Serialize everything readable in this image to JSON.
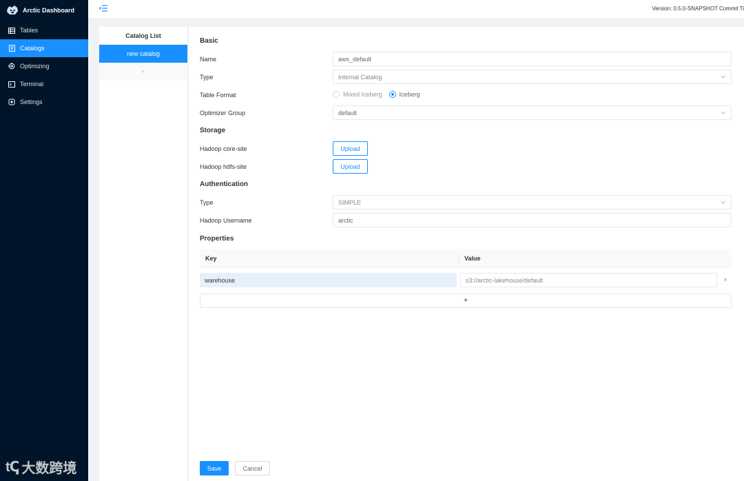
{
  "app": {
    "title": "Arctic Dashboard",
    "logo_icon": "arctic-bear-logo"
  },
  "header": {
    "version": "Version: 0.5.0-SNAPSHOT   Commit Ti"
  },
  "sidebar": {
    "items": [
      {
        "label": "Tables",
        "icon": "table-icon",
        "active": false
      },
      {
        "label": "Catalogs",
        "icon": "catalog-icon",
        "active": true
      },
      {
        "label": "Optimizing",
        "icon": "optimizing-icon",
        "active": false
      },
      {
        "label": "Terminal",
        "icon": "terminal-icon",
        "active": false
      },
      {
        "label": "Settings",
        "icon": "settings-icon",
        "active": false
      }
    ]
  },
  "catalog_list": {
    "title": "Catalog List",
    "items": [
      "new catalog"
    ],
    "add_label": "+"
  },
  "form": {
    "basic": {
      "title": "Basic",
      "name_label": "Name",
      "name_value": "aws_default",
      "type_label": "Type",
      "type_value": "Internal Catalog",
      "table_format_label": "Table Format",
      "table_format_options": [
        "Mixed Iceberg",
        "Iceberg"
      ],
      "table_format_selected": "Iceberg",
      "optimizer_group_label": "Optimizer Group",
      "optimizer_group_value": "default"
    },
    "storage": {
      "title": "Storage",
      "core_site_label": "Hadoop core-site",
      "hdfs_site_label": "Hadoop hdfs-site",
      "upload_label": "Upload"
    },
    "authentication": {
      "title": "Authentication",
      "type_label": "Type",
      "type_value": "SIMPLE",
      "username_label": "Hadoop Username",
      "username_value": "arctic"
    },
    "properties": {
      "title": "Properties",
      "key_header": "Key",
      "value_header": "Value",
      "rows": [
        {
          "key": "warehouse",
          "value": "s3://arctic-lakehouse/default"
        }
      ],
      "delete_label": "×",
      "add_label": "+"
    },
    "actions": {
      "save": "Save",
      "cancel": "Cancel"
    }
  },
  "watermark": {
    "logo": "tↅ",
    "text": "大数跨境"
  },
  "colors": {
    "sidebar_bg": "#001529",
    "primary": "#1890ff"
  }
}
